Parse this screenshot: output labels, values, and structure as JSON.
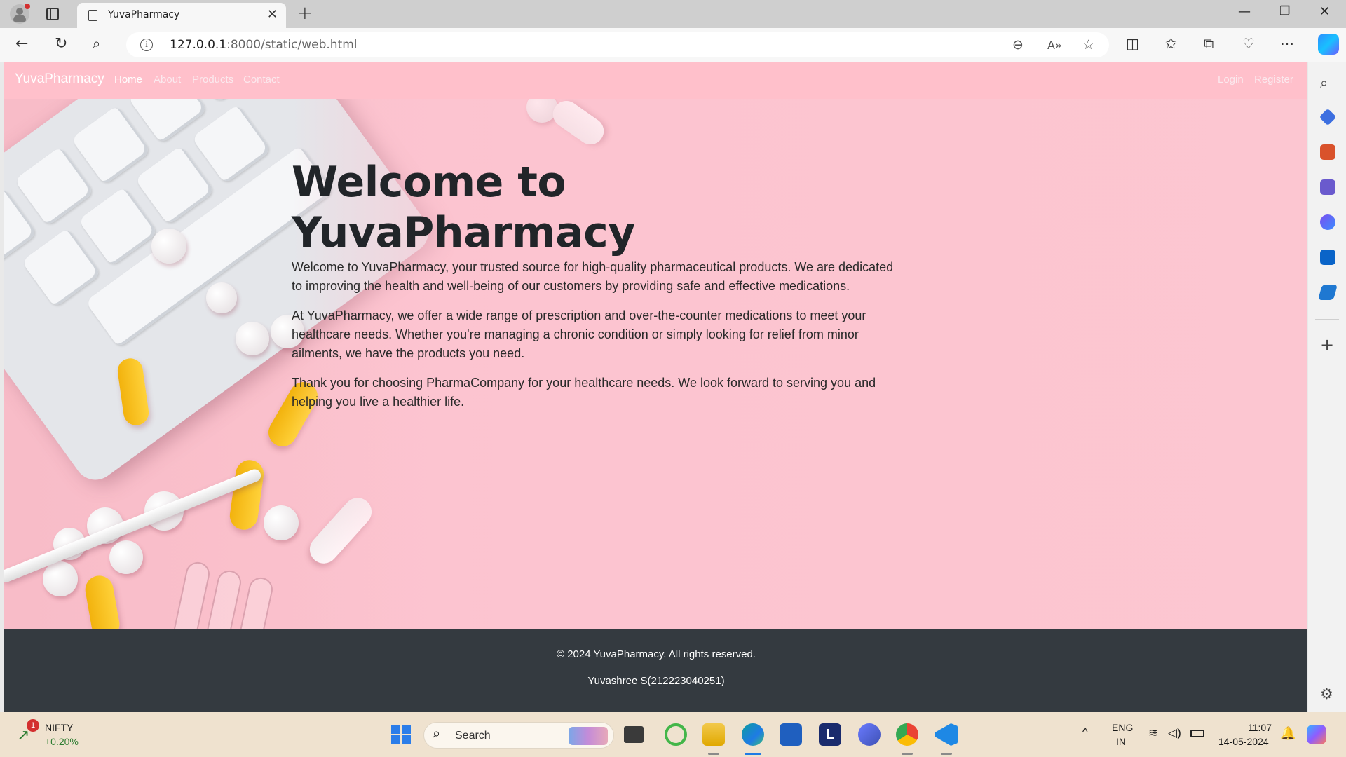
{
  "browser": {
    "tab_title": "YuvaPharmacy",
    "url_host": "127.0.0.1",
    "url_rest": ":8000/static/web.html",
    "window_controls": [
      "minimize-icon",
      "restore-icon",
      "close-icon"
    ]
  },
  "site": {
    "brand": "YuvaPharmacy",
    "nav_left": [
      "Home",
      "About",
      "Products",
      "Contact"
    ],
    "nav_right": [
      "Login",
      "Register"
    ],
    "active_nav": "Home",
    "accent_color": "#ffc0cb",
    "footer_color": "#343a40"
  },
  "hero": {
    "title": "Welcome to YuvaPharmacy",
    "paragraphs": [
      "Welcome to YuvaPharmacy, your trusted source for high-quality pharmaceutical products. We are dedicated to improving the health and well-being of our customers by providing safe and effective medications.",
      "At YuvaPharmacy, we offer a wide range of prescription and over-the-counter medications to meet your healthcare needs. Whether you're managing a chronic condition or simply looking for relief from minor ailments, we have the products you need.",
      "Thank you for choosing PharmaCompany for your healthcare needs. We look forward to serving you and helping you live a healthier life."
    ]
  },
  "footer": {
    "copyright": "© 2024 YuvaPharmacy. All rights reserved.",
    "author": "Yuvashree S(212223040251)"
  },
  "taskbar": {
    "stock_name": "NIFTY",
    "stock_change": "+0.20%",
    "stock_badge": "1",
    "search_placeholder": "Search",
    "lang_top": "ENG",
    "lang_bottom": "IN",
    "time": "11:07",
    "date": "14-05-2024",
    "stock_color": "#2e7d32"
  }
}
